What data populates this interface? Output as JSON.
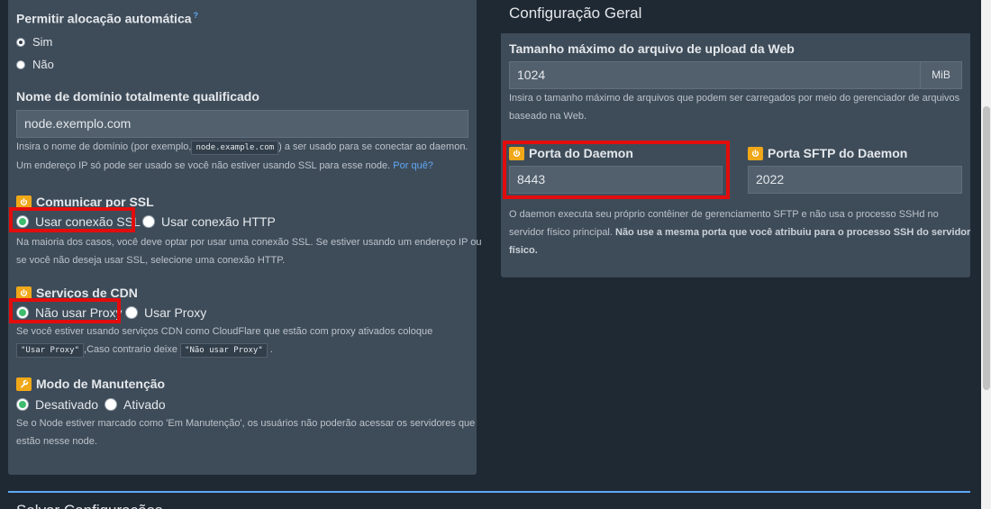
{
  "left": {
    "auto_alloc": {
      "label": "Permitir alocação automática",
      "help_marker": "?",
      "options": [
        "Sim",
        "Não"
      ]
    },
    "fqdn": {
      "label": "Nome de domínio totalmente qualificado",
      "value": "node.exemplo.com",
      "help_pre": "Insira o nome de domínio (por exemplo,",
      "help_code": "node.example.com",
      "help_post": ") a ser usado para se conectar ao daemon.",
      "help_line2": "Um endereço IP só pode ser usado se você não estiver usando SSL para esse node.",
      "help_link": "Por quê?"
    },
    "ssl": {
      "label": "Comunicar por SSL",
      "options": [
        "Usar conexão SSL",
        "Usar conexão HTTP"
      ],
      "help_line1": "Na maioria dos casos, você deve optar por usar uma conexão SSL. Se estiver usando um endereço IP ou",
      "help_line2": "se você não deseja usar SSL, selecione uma conexão HTTP."
    },
    "cdn": {
      "label": "Serviços de CDN",
      "options": [
        "Não usar Proxy",
        "Usar Proxy"
      ],
      "help_line1": "Se você estiver usando serviços CDN como CloudFlare que estão com proxy ativados coloque",
      "help_code1": "\"Usar Proxy\"",
      "help_mid": ",Caso contrario deixe",
      "help_code2": "\"Não usar Proxy\"",
      "help_end": "."
    },
    "maintenance": {
      "label": "Modo de Manutenção",
      "options": [
        "Desativado",
        "Ativado"
      ],
      "help_line1": "Se o Node estiver marcado como 'Em Manutenção', os usuários não poderão acessar os servidores que",
      "help_line2": "estão nesse node."
    }
  },
  "right": {
    "title": "Configuração Geral",
    "upload": {
      "label": "Tamanho máximo do arquivo de upload da Web",
      "value": "1024",
      "unit": "MiB",
      "help_line1": "Insira o tamanho máximo de arquivos que podem ser carregados por meio do gerenciador de arquivos",
      "help_line2": "baseado na Web."
    },
    "daemon_port": {
      "label": "Porta do Daemon",
      "value": "8443"
    },
    "sftp_port": {
      "label": "Porta SFTP do Daemon",
      "value": "2022"
    },
    "help_line1": "O daemon executa seu próprio contêiner de gerenciamento SFTP e não usa o processo SSHd no",
    "help_line2_plain": "servidor físico principal.",
    "help_line2_bold": "Não use a mesma porta que você atribuiu para o processo SSH do servidor",
    "help_line3_bold": "físico."
  },
  "bottom": {
    "title": "Salvar Configurações"
  },
  "colors": {
    "highlight": "#e30c0c",
    "badge": "#f0a818",
    "radio_checked": "#3ebd6e",
    "link": "#5fa8f5"
  }
}
